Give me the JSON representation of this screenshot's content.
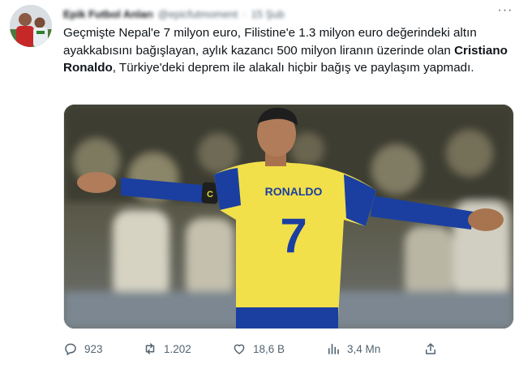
{
  "tweet": {
    "author_name": "Epik Futbol Anları",
    "handle": "@epicfutmoment",
    "separator": "·",
    "date": "15 Şub",
    "more_label": "···",
    "text_before": "Geçmişte Nepal'e 7 milyon euro, Filistine'e 1.3 milyon euro değerindeki altın ayakkabısını bağışlayan, aylık kazancı 500 milyon liranın üzerinde olan ",
    "text_bold": "Cristiano Ronaldo",
    "text_after": ", Türkiye'deki deprem ile alakalı hiçbir bağış ve paylaşım yapmadı.",
    "media": {
      "jersey_name": "RONALDO",
      "jersey_number": "7",
      "armband": "C"
    },
    "actions": {
      "replies": "923",
      "retweets": "1.202",
      "likes": "18,6 B",
      "views": "3,4 Mn"
    }
  },
  "colors": {
    "text": "#0f1419",
    "secondary": "#536471",
    "jersey_yellow": "#f2e04a",
    "jersey_blue": "#1b3fa0"
  }
}
